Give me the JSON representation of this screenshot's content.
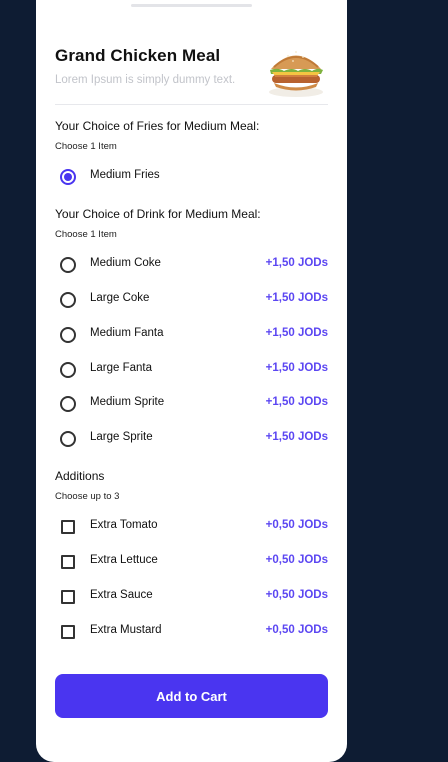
{
  "meal": {
    "title": "Grand Chicken Meal",
    "description": "Lorem Ipsum is simply dummy text."
  },
  "fries_section": {
    "title": "Your Choice of Fries for Medium Meal:",
    "hint": "Choose 1 Item",
    "options": [
      {
        "label": "Medium Fries",
        "price": "",
        "selected": true
      }
    ]
  },
  "drink_section": {
    "title": "Your Choice of Drink for Medium Meal:",
    "hint": "Choose 1 Item",
    "options": [
      {
        "label": "Medium Coke",
        "price": "+1,50 JODs",
        "selected": false
      },
      {
        "label": "Large Coke",
        "price": "+1,50 JODs",
        "selected": false
      },
      {
        "label": "Medium Fanta",
        "price": "+1,50 JODs",
        "selected": false
      },
      {
        "label": "Large Fanta",
        "price": "+1,50 JODs",
        "selected": false
      },
      {
        "label": "Medium Sprite",
        "price": "+1,50 JODs",
        "selected": false
      },
      {
        "label": "Large Sprite",
        "price": "+1,50 JODs",
        "selected": false
      }
    ]
  },
  "additions_section": {
    "title": "Additions",
    "hint": "Choose up to 3",
    "options": [
      {
        "label": "Extra Tomato",
        "price": "+0,50 JODs",
        "checked": false
      },
      {
        "label": "Extra Lettuce",
        "price": "+0,50 JODs",
        "checked": false
      },
      {
        "label": "Extra Sauce",
        "price": "+0,50 JODs",
        "checked": false
      },
      {
        "label": "Extra Mustard",
        "price": "+0,50 JODs",
        "checked": false
      }
    ]
  },
  "cart_button": {
    "label": "Add to Cart"
  },
  "colors": {
    "background": "#0e1c33",
    "accent": "#4a35f0",
    "price": "#5b46f2"
  },
  "icons": {
    "meal_image": "burger-image",
    "radio": "radio-icon",
    "checkbox": "checkbox-icon"
  }
}
